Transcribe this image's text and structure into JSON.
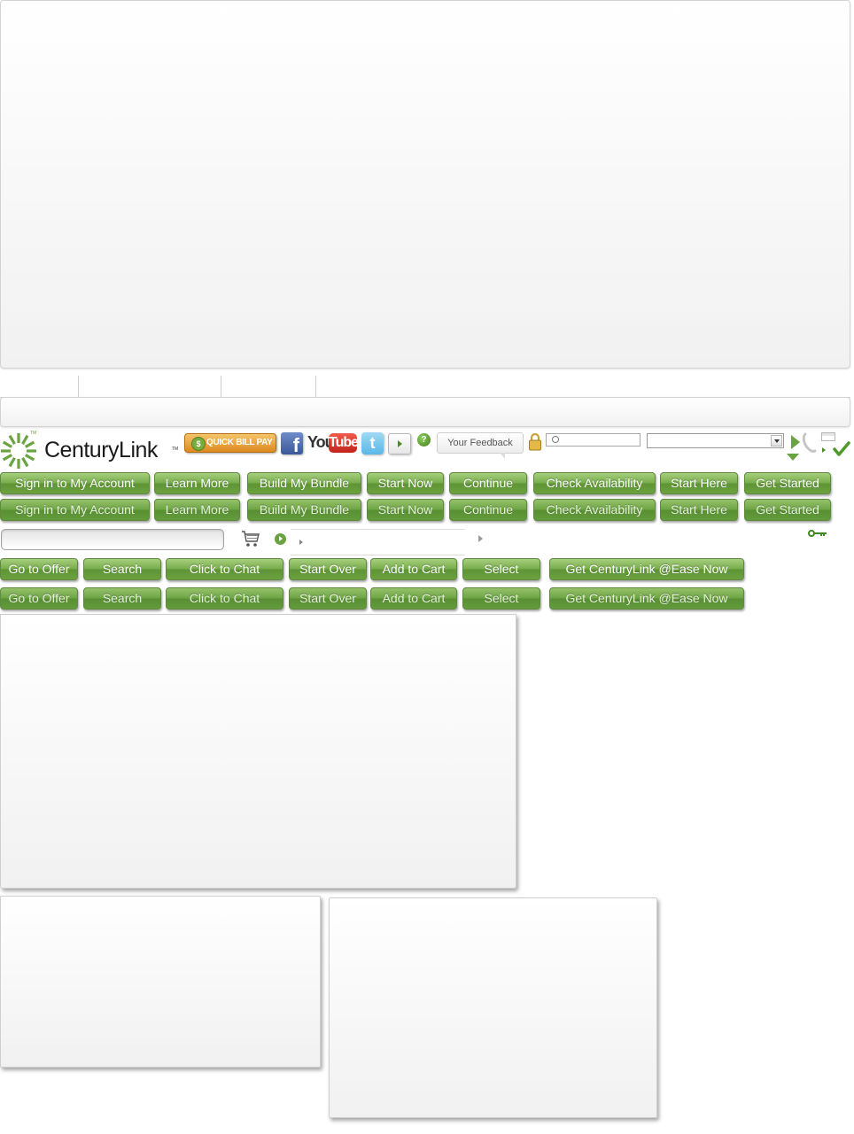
{
  "header": {
    "brand_name": "CenturyLink",
    "brand_tm": "TM",
    "brand_mark_tm": "TM",
    "quick_bill_pay_label": "QUICK BILL PAY",
    "facebook_label": "f",
    "youtube_you": "You",
    "youtube_tube": "Tube",
    "twitter_label": "t",
    "help_label": "?",
    "feedback_label": "Your Feedback",
    "search_value": "",
    "select_value": ""
  },
  "buttons_row1": [
    "Sign in to My Account",
    "Learn More",
    "Build My Bundle",
    "Start Now",
    "Continue",
    "Check Availability",
    "Start Here",
    "Get Started"
  ],
  "buttons_row2": [
    "Sign in to My Account",
    "Learn More",
    "Build My Bundle",
    "Start Now",
    "Continue",
    "Check Availability",
    "Start Here",
    "Get Started"
  ],
  "buttons_row3": [
    "Go to Offer",
    "Search",
    "Click to Chat",
    "Start Over",
    "Add to Cart",
    "Select",
    "Get CenturyLink @Ease Now"
  ],
  "buttons_row4": [
    "Go to Offer",
    "Search",
    "Click to Chat",
    "Start Over",
    "Add to Cart",
    "Select",
    "Get CenturyLink @Ease Now"
  ],
  "tools_row": {
    "text_input_value": ""
  },
  "colors": {
    "brand_green": "#6aa341",
    "button_border": "#5d8a3e",
    "quick_pay_orange": "#e8a13a",
    "facebook_blue": "#3b5998",
    "youtube_red": "#d62a1f",
    "twitter_blue": "#5ab7e6"
  }
}
